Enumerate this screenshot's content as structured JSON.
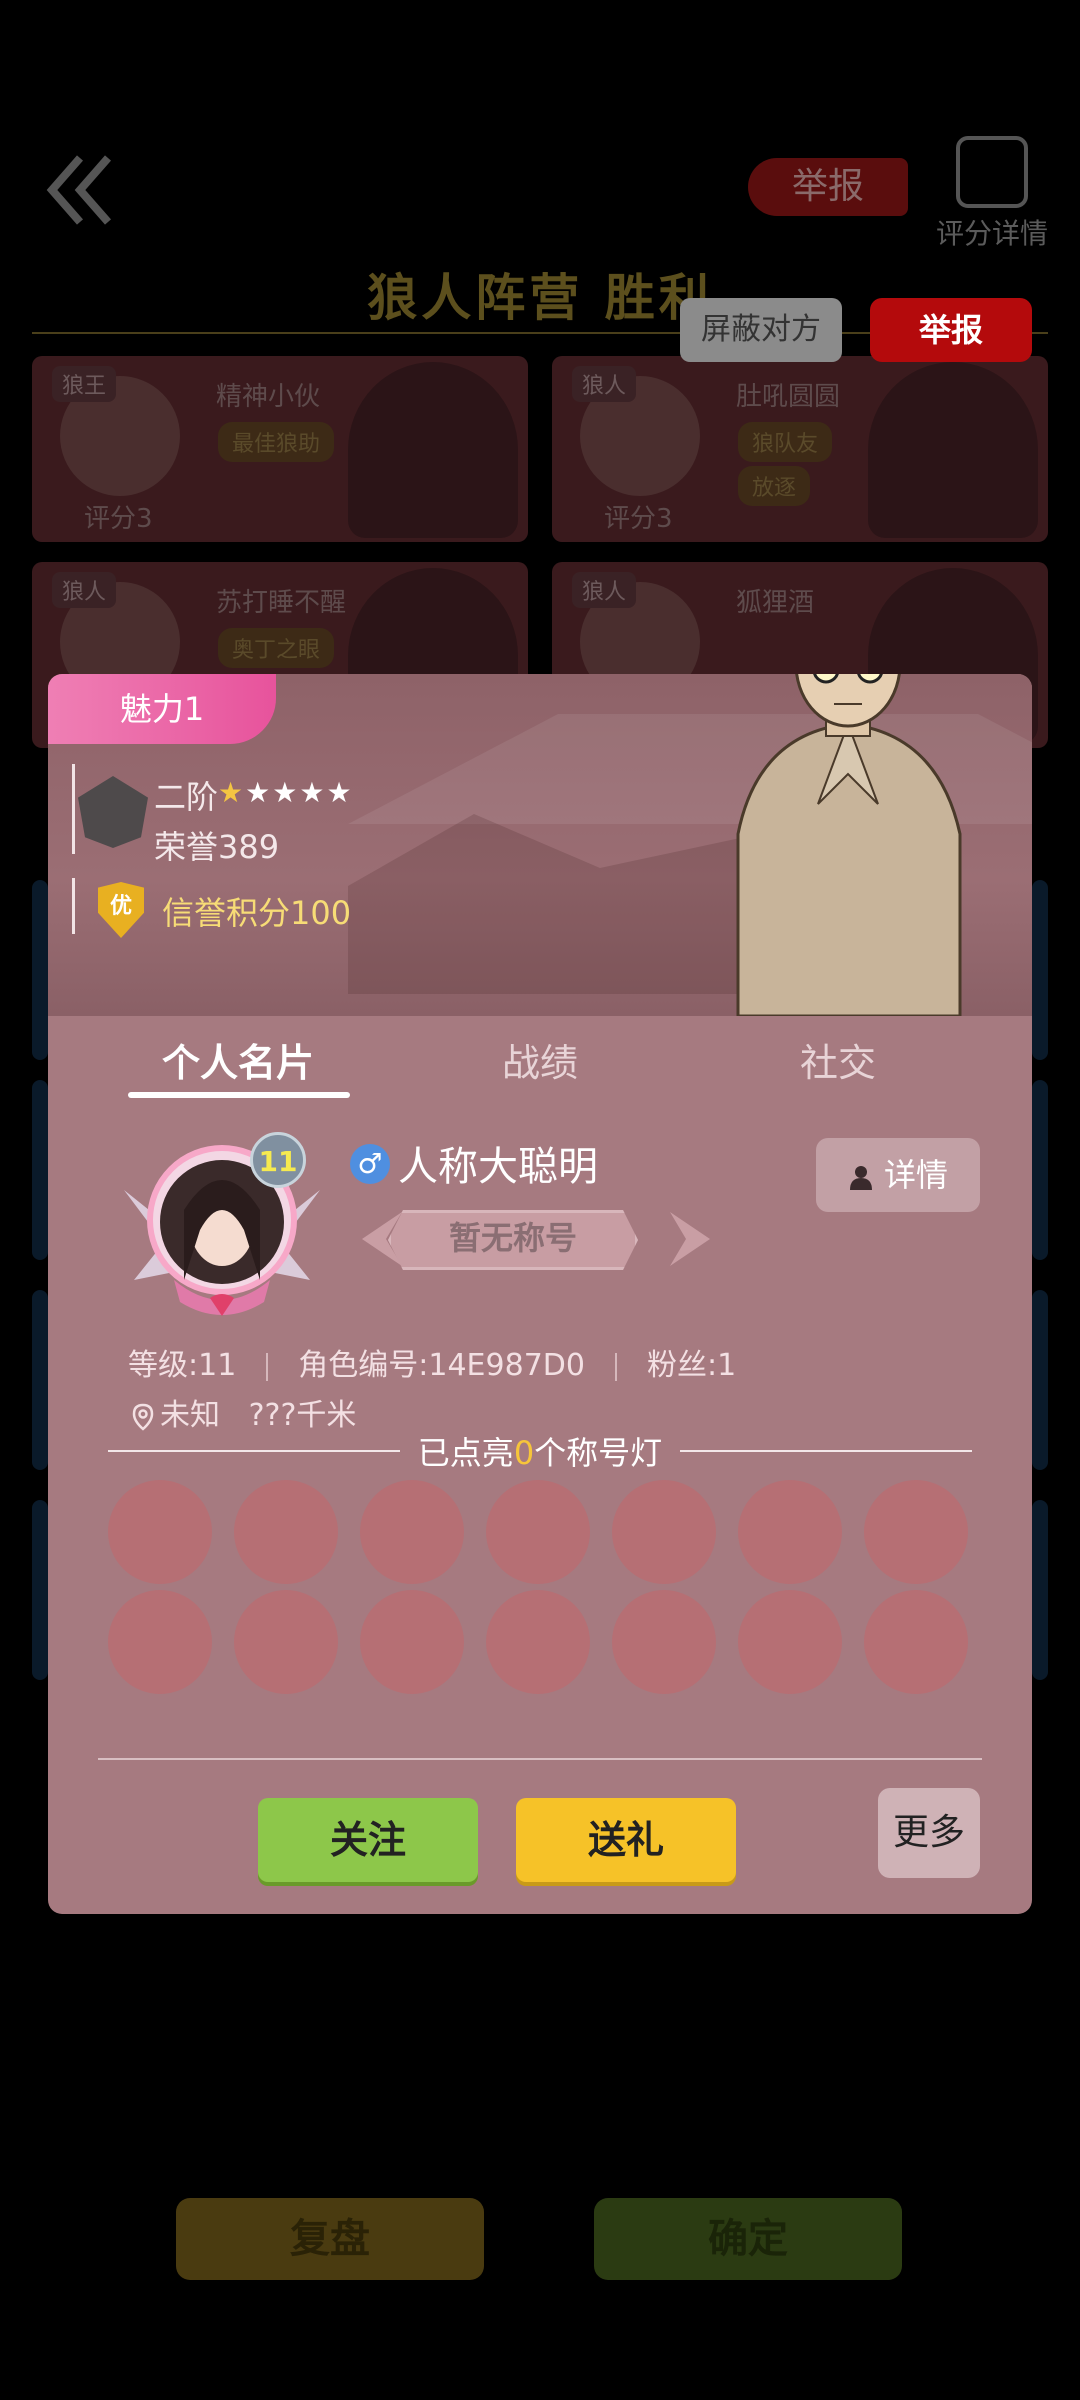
{
  "background": {
    "report_label": "举报",
    "score_detail_label": "评分详情",
    "result_title": "狼人阵营  胜利",
    "cards": [
      {
        "role": "狼王",
        "name": "精神小伙",
        "tag": "最佳狼助",
        "score_label": "评分3",
        "avatar_num": "2"
      },
      {
        "role": "狼人",
        "name": "肚吼圆圆",
        "tag": "狼队友",
        "tag2": "放逐",
        "score_label": "评分3",
        "avatar_num": "3"
      },
      {
        "role": "狼人",
        "name": "苏打睡不醒",
        "tag": "奥丁之眼",
        "score_label": "",
        "avatar_num": ""
      },
      {
        "role": "狼人",
        "name": "狐狸酒",
        "tag": "",
        "score_label": "",
        "avatar_num": ""
      }
    ],
    "replay_label": "复盘",
    "confirm_label": "确定"
  },
  "top_actions": {
    "block_label": "屏蔽对方",
    "report_label": "举报"
  },
  "popup": {
    "charm_label": "魅力",
    "charm_value": "1",
    "rank_label": "二阶",
    "stars_filled": 1,
    "stars_total": 5,
    "honor_label": "荣誉389",
    "credit_badge": "优",
    "credit_label": "信誉积分100",
    "tabs": [
      {
        "label": "个人名片",
        "active": true
      },
      {
        "label": "战绩",
        "active": false
      },
      {
        "label": "社交",
        "active": false
      }
    ],
    "profile": {
      "level_badge": "11",
      "gender_symbol": "♂",
      "nickname": "人称大聪明",
      "title_badge": "暂无称号",
      "details_label": "详情",
      "level_text": "等级:11",
      "role_id_text": "角色编号:14E987D0",
      "fans_text": "粉丝:1",
      "location_text": "未知",
      "distance_text": "???千米"
    },
    "lights": {
      "prefix": "已点亮",
      "count": "0",
      "suffix": "个称号灯",
      "total_slots": 14
    },
    "buttons": {
      "follow_label": "关注",
      "gift_label": "送礼",
      "more_label": "更多"
    },
    "colors": {
      "panel": "#a67a80",
      "charm_pink": "#e7539c",
      "follow_green": "#8dc74a",
      "gift_yellow": "#f6c228",
      "report_red": "#b40a0c",
      "highlight": "#f7c53a"
    }
  }
}
